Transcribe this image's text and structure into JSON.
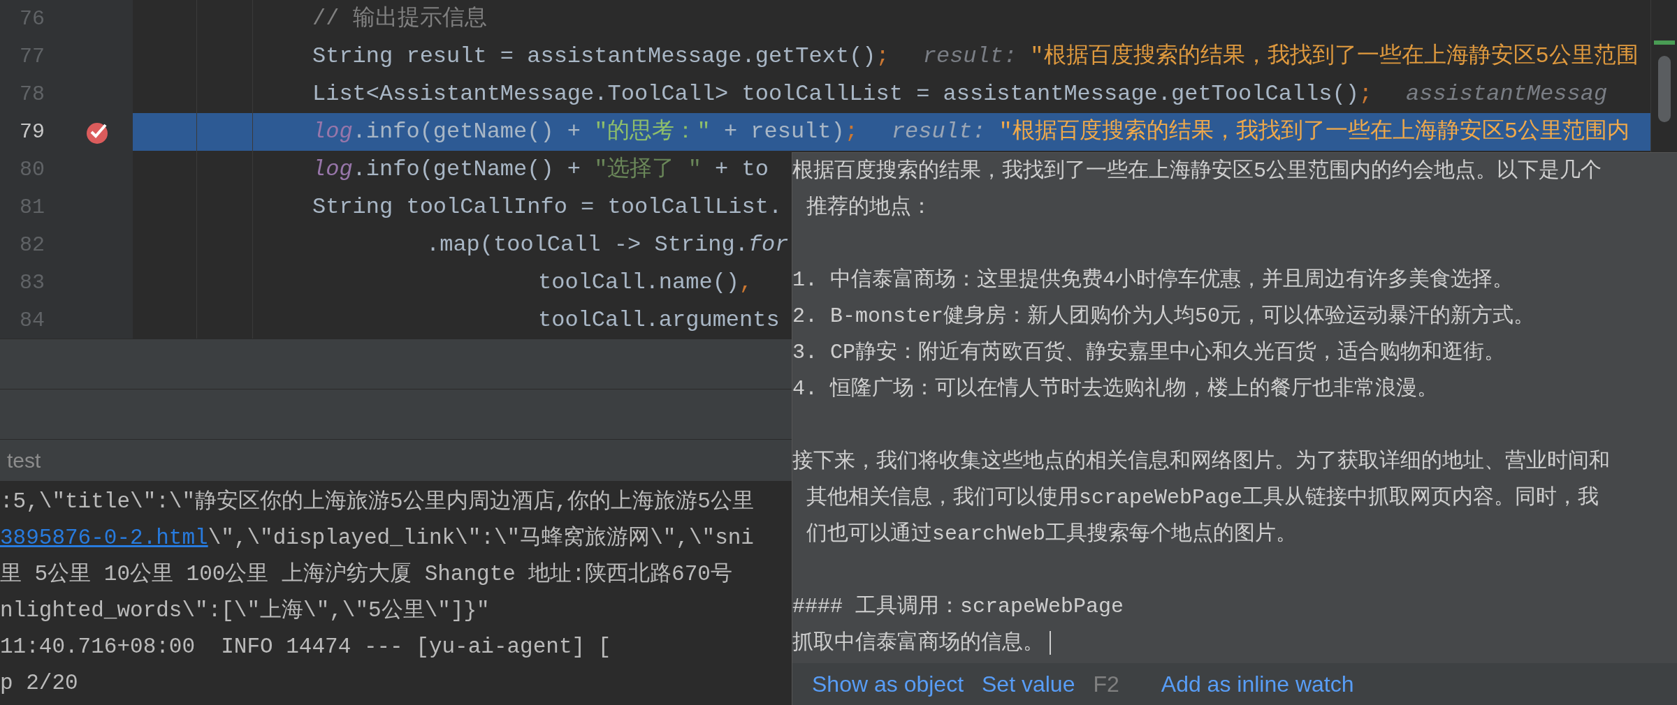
{
  "editor": {
    "lines": [
      {
        "number": "76",
        "selected": false,
        "breakpoint": false,
        "kind": "statement",
        "tokens": [
          {
            "kind": "comment",
            "text": "// 输出提示信息"
          }
        ]
      },
      {
        "number": "77",
        "selected": false,
        "breakpoint": false,
        "kind": "statement",
        "tokens": [
          {
            "kind": "code",
            "text": "String result = assistantMessage.getText()"
          },
          {
            "kind": "punct",
            "text": ";"
          },
          {
            "kind": "hint_label",
            "text": "result: "
          },
          {
            "kind": "hint_value",
            "text": "\"根据百度搜索的结果，我找到了一些在上海静安区5公里范围"
          }
        ]
      },
      {
        "number": "78",
        "selected": false,
        "breakpoint": false,
        "kind": "statement",
        "tokens": [
          {
            "kind": "code",
            "text": "List<AssistantMessage.ToolCall> toolCallList = assistantMessage.getToolCalls()"
          },
          {
            "kind": "punct",
            "text": ";"
          },
          {
            "kind": "hint_label",
            "text": "assistantMessag"
          }
        ]
      },
      {
        "number": "79",
        "selected": true,
        "breakpoint": true,
        "kind": "statement",
        "tokens": [
          {
            "kind": "field",
            "text": "log"
          },
          {
            "kind": "code",
            "text": ".info(getName() + "
          },
          {
            "kind": "string",
            "text": "\"的思考：\""
          },
          {
            "kind": "code",
            "text": " + result)"
          },
          {
            "kind": "punct",
            "text": ";"
          },
          {
            "kind": "hint_label",
            "text": "result: "
          },
          {
            "kind": "hint_value",
            "text": "\"根据百度搜索的结果，我找到了一些在上海静安区5公里范围内"
          }
        ]
      },
      {
        "number": "80",
        "selected": false,
        "breakpoint": false,
        "kind": "statement",
        "tokens": [
          {
            "kind": "field",
            "text": "log"
          },
          {
            "kind": "code",
            "text": ".info(getName() + "
          },
          {
            "kind": "string",
            "text": "\"选择了 \""
          },
          {
            "kind": "code",
            "text": " + to"
          }
        ]
      },
      {
        "number": "81",
        "selected": false,
        "breakpoint": false,
        "kind": "statement",
        "tokens": [
          {
            "kind": "code",
            "text": "String toolCallInfo = toolCallList."
          }
        ]
      },
      {
        "number": "82",
        "selected": false,
        "breakpoint": false,
        "kind": "continuation",
        "tokens": [
          {
            "kind": "code",
            "text": ".map(toolCall -> String."
          },
          {
            "kind": "italic",
            "text": "for"
          }
        ]
      },
      {
        "number": "83",
        "selected": false,
        "breakpoint": false,
        "kind": "argument",
        "tokens": [
          {
            "kind": "code",
            "text": "toolCall.name()"
          },
          {
            "kind": "punct",
            "text": ","
          }
        ]
      },
      {
        "number": "84",
        "selected": false,
        "breakpoint": false,
        "kind": "argument",
        "tokens": [
          {
            "kind": "code",
            "text": "toolCall.arguments"
          }
        ]
      }
    ]
  },
  "run_panel": {
    "tab": "test",
    "console_lines": [
      [
        {
          "kind": "plain",
          "text": ":5,\\\"title\\\":\\\"静安区你的上海旅游5公里内周边酒店,你的上海旅游5公里"
        }
      ],
      [
        {
          "kind": "link",
          "text": "3895876-0-2.html"
        },
        {
          "kind": "plain",
          "text": "\\\",\\\"displayed_link\\\":\\\"马蜂窝旅游网\\\",\\\"sni"
        }
      ],
      [
        {
          "kind": "plain",
          "text": "里 5公里 10公里 100公里 上海沪纺大厦 Shangte 地址:陕西北路670号"
        }
      ],
      [
        {
          "kind": "plain",
          "text": "nlighted_words\\\":[\\\"上海\\\",\\\"5公里\\\"]}\""
        }
      ],
      [
        {
          "kind": "plain",
          "text": "11:40.716+08:00  INFO 14474 --- [yu-ai-agent] ["
        }
      ],
      [
        {
          "kind": "plain",
          "text": "p 2/20"
        }
      ]
    ]
  },
  "value_popup": {
    "paragraphs": [
      {
        "kind": "wrapped",
        "lines": [
          "根据百度搜索的结果，我找到了一些在上海静安区5公里范围内的约会地点。以下是几个",
          "推荐的地点："
        ]
      },
      {
        "kind": "list",
        "lines": [
          "1. 中信泰富商场：这里提供免费4小时停车优惠，并且周边有许多美食选择。",
          "2. B-monster健身房：新人团购价为人均50元，可以体验运动暴汗的新方式。",
          "3. CP静安：附近有芮欧百货、静安嘉里中心和久光百货，适合购物和逛街。",
          "4. 恒隆广场：可以在情人节时去选购礼物，楼上的餐厅也非常浪漫。"
        ]
      },
      {
        "kind": "wrapped",
        "lines": [
          "接下来，我们将收集这些地点的相关信息和网络图片。为了获取详细的地址、营业时间和",
          "其他相关信息，我们可以使用scrapeWebPage工具从链接中抓取网页内容。同时，我",
          "们也可以通过searchWeb工具搜索每个地点的图片。"
        ]
      },
      {
        "kind": "list",
        "lines": [
          "#### 工具调用：scrapeWebPage",
          "抓取中信泰富商场的信息。"
        ]
      }
    ],
    "actions": [
      {
        "kind": "link",
        "text": "Show as object"
      },
      {
        "kind": "link",
        "text": "Set value"
      },
      {
        "kind": "shortcut",
        "text": "F2"
      },
      {
        "kind": "link",
        "text": "Add as inline watch"
      }
    ]
  }
}
